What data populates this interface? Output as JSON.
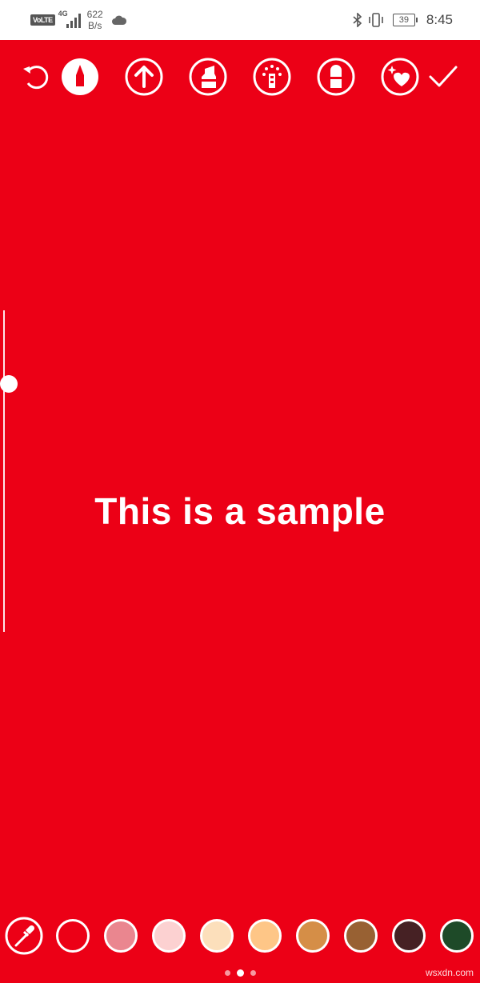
{
  "status_bar": {
    "volte": "VoLTE",
    "network": "4G",
    "speed_value": "622",
    "speed_unit": "B/s",
    "battery": "39",
    "time": "8:45"
  },
  "toolbar": {
    "tools": [
      {
        "icon": "undo-icon"
      },
      {
        "icon": "marker-pen-icon",
        "selected": true
      },
      {
        "icon": "arrow-up-icon"
      },
      {
        "icon": "highlighter-icon"
      },
      {
        "icon": "neon-pen-icon"
      },
      {
        "icon": "eraser-icon"
      },
      {
        "icon": "sparkle-heart-icon"
      },
      {
        "icon": "checkmark-icon"
      }
    ]
  },
  "canvas": {
    "background": "#ec0016",
    "text": "This is a sample",
    "brush_size_level": 0.77
  },
  "palette": {
    "colors": [
      "#ec0016",
      "#ea868f",
      "#fcd1d1",
      "#fcdfbb",
      "#fec687",
      "#d58e47",
      "#986133",
      "#462124",
      "#1e4a28"
    ],
    "selected_color": "#ec0016"
  },
  "pager": {
    "pages": 3,
    "current": 2
  },
  "watermark": "wsxdn.com"
}
